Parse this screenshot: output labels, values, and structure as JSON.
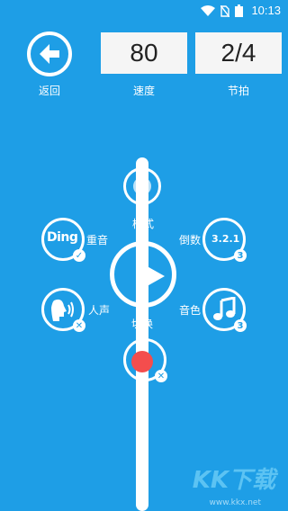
{
  "status": {
    "time": "10:13"
  },
  "header": {
    "back_label": "返回",
    "speed_value": "80",
    "speed_label": "速度",
    "beat_value": "2/4",
    "beat_label": "节拍"
  },
  "controls": {
    "mode_label": "模式",
    "switch_label": "切换",
    "accent_label": "重音",
    "accent_icon_text": "Ding",
    "voice_label": "人声",
    "countdown_label": "倒数",
    "countdown_icon_text": "3.2.1",
    "countdown_badge": "3",
    "tone_label": "音色",
    "tone_badge": "3"
  },
  "watermark": {
    "text": "KK下载",
    "url": "www.kkx.net"
  },
  "colors": {
    "background": "#1e9ee6",
    "record": "#f44d4d",
    "box": "#f5f5f5"
  }
}
